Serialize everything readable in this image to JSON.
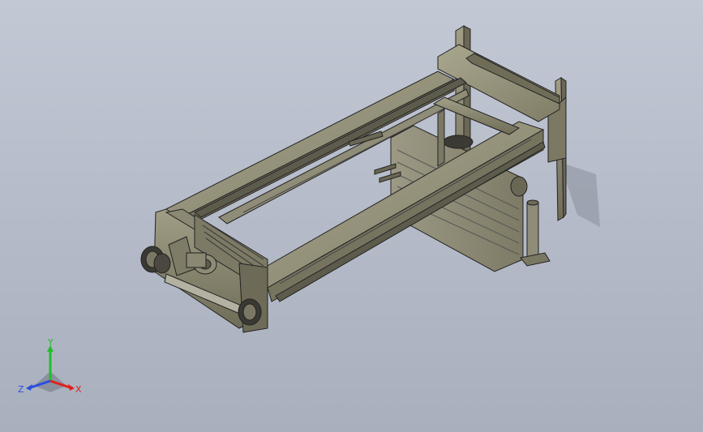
{
  "viewport": {
    "background_top": "#c2c8d4",
    "background_bottom": "#a9b0bd"
  },
  "model": {
    "steel_color": "#8e8b74",
    "steel_dark": "#5f5d4c",
    "edge_color": "#222222"
  },
  "triad": {
    "x_label": "X",
    "y_label": "Y",
    "z_label": "Z",
    "x_color": "#e0201c",
    "y_color": "#1fbf2a",
    "z_color": "#2a4ee0"
  }
}
